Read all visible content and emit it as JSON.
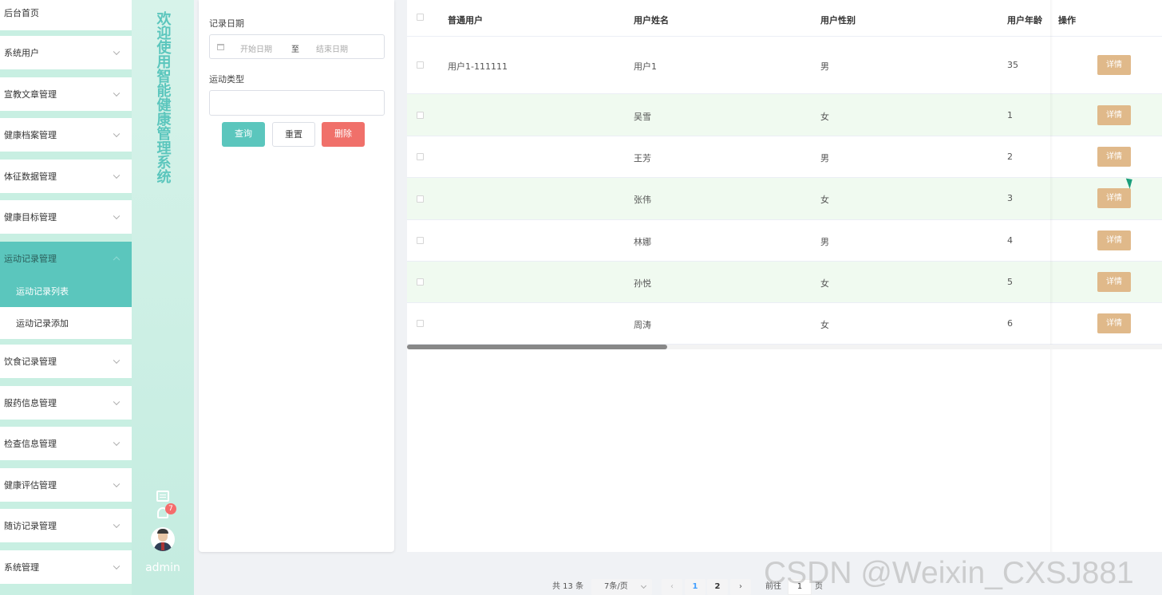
{
  "sidebar": {
    "items": [
      {
        "label": "后台首页"
      },
      {
        "label": "系统用户"
      },
      {
        "label": "宣教文章管理"
      },
      {
        "label": "健康档案管理"
      },
      {
        "label": "体征数据管理"
      },
      {
        "label": "健康目标管理"
      },
      {
        "label": "运动记录管理"
      },
      {
        "label": "饮食记录管理"
      },
      {
        "label": "服药信息管理"
      },
      {
        "label": "检查信息管理"
      },
      {
        "label": "健康评估管理"
      },
      {
        "label": "随访记录管理"
      },
      {
        "label": "系统管理"
      }
    ],
    "sub_items": [
      {
        "label": "运动记录列表"
      },
      {
        "label": "运动记录添加"
      }
    ]
  },
  "welcome": {
    "title": "欢迎使用智能健康管理系统",
    "badge_count": "7",
    "username": "admin"
  },
  "search": {
    "date_label": "记录日期",
    "date_start_placeholder": "开始日期",
    "date_separator": "至",
    "date_end_placeholder": "结束日期",
    "type_label": "运动类型",
    "type_value": "",
    "query_button": "查询",
    "reset_button": "重置",
    "delete_button": "删除"
  },
  "table": {
    "columns": [
      "普通用户",
      "用户姓名",
      "用户性别",
      "用户年龄",
      "操作"
    ],
    "detail_label": "详情",
    "rows": [
      {
        "account": "用户1-111111",
        "name": "用户1",
        "gender": "男",
        "age": "35"
      },
      {
        "account": "",
        "name": "吴雪",
        "gender": "女",
        "age": "1"
      },
      {
        "account": "",
        "name": "王芳",
        "gender": "男",
        "age": "2"
      },
      {
        "account": "",
        "name": "张伟",
        "gender": "女",
        "age": "3"
      },
      {
        "account": "",
        "name": "林娜",
        "gender": "男",
        "age": "4"
      },
      {
        "account": "",
        "name": "孙悦",
        "gender": "女",
        "age": "5"
      },
      {
        "account": "",
        "name": "周涛",
        "gender": "女",
        "age": "6"
      }
    ]
  },
  "pagination": {
    "total": "共 13 条",
    "page_size": "7条/页",
    "pages": [
      "1",
      "2"
    ],
    "current_page": "1",
    "goto_label": "前往",
    "goto_value": "1",
    "goto_suffix": "页"
  },
  "watermark": "CSDN @Weixin_CXSJ881"
}
